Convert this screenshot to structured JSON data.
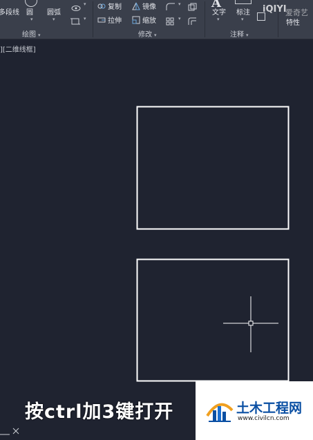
{
  "ribbon": {
    "draw_panel": {
      "title": "绘图",
      "items": {
        "polyline": "多段线",
        "circle": "圆",
        "arc": "圆弧"
      }
    },
    "modify_panel": {
      "title": "修改",
      "items": {
        "copy": "复制",
        "mirror": "镜像",
        "stretch": "拉伸",
        "scale": "缩放"
      }
    },
    "annotation_panel": {
      "title": "注释",
      "items": {
        "text": "文字",
        "dimension": "标注"
      }
    },
    "extra": {
      "properties": "特性"
    }
  },
  "viewport": {
    "label": "][二维线框]"
  },
  "subtitle": "按ctrl加3键打开",
  "overlay": {
    "video_logo": "iQIYI",
    "video_logo_sub": "爱奇艺"
  },
  "watermark": {
    "title": "土木工程网",
    "url": "www.civilcn.com"
  },
  "colors": {
    "canvas_bg": "#1f2330",
    "ribbon_bg": "#3a3f4b",
    "drawing_lines": "#ffffff",
    "watermark_blue": "#0a4fa3"
  },
  "icons": [
    "view-icon",
    "rectangle-icon",
    "copy-icon",
    "mirror-icon",
    "stretch-icon",
    "scale-icon",
    "fillet-icon",
    "array-icon",
    "offset-icon",
    "ucs-icon",
    "crosshair-cursor"
  ]
}
